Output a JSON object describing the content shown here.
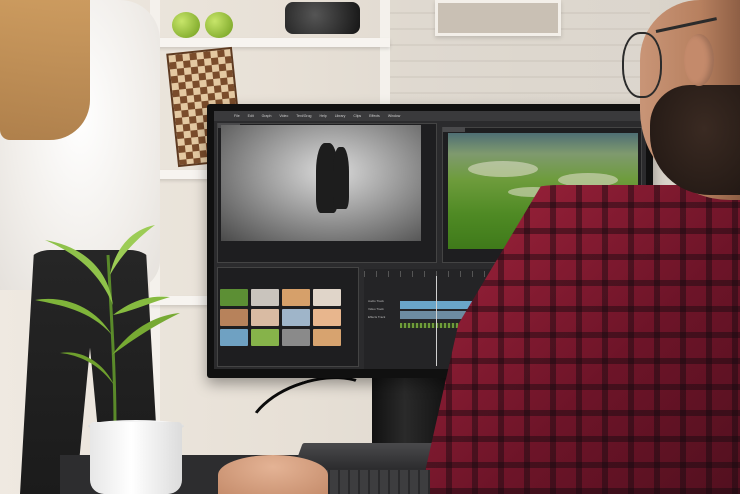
{
  "scene": {
    "subject": "video editor at desk",
    "monitor": {
      "menu_items": [
        "File",
        "Edit",
        "Graph",
        "Video",
        "Text/Grog",
        "Help",
        "Library",
        "Clips",
        "Effects",
        "Window"
      ],
      "left_preview": "dancing couple",
      "right_preview": "aerial landscape",
      "track_labels": [
        "Audio Track",
        "Video Track",
        "Effects Track"
      ]
    }
  },
  "colors": {
    "shirt": "#a3243d",
    "screen_bg": "#2b2b2d",
    "timeline_clip": "#6aa5c8",
    "timeline_audio": "#6f9c3a"
  }
}
